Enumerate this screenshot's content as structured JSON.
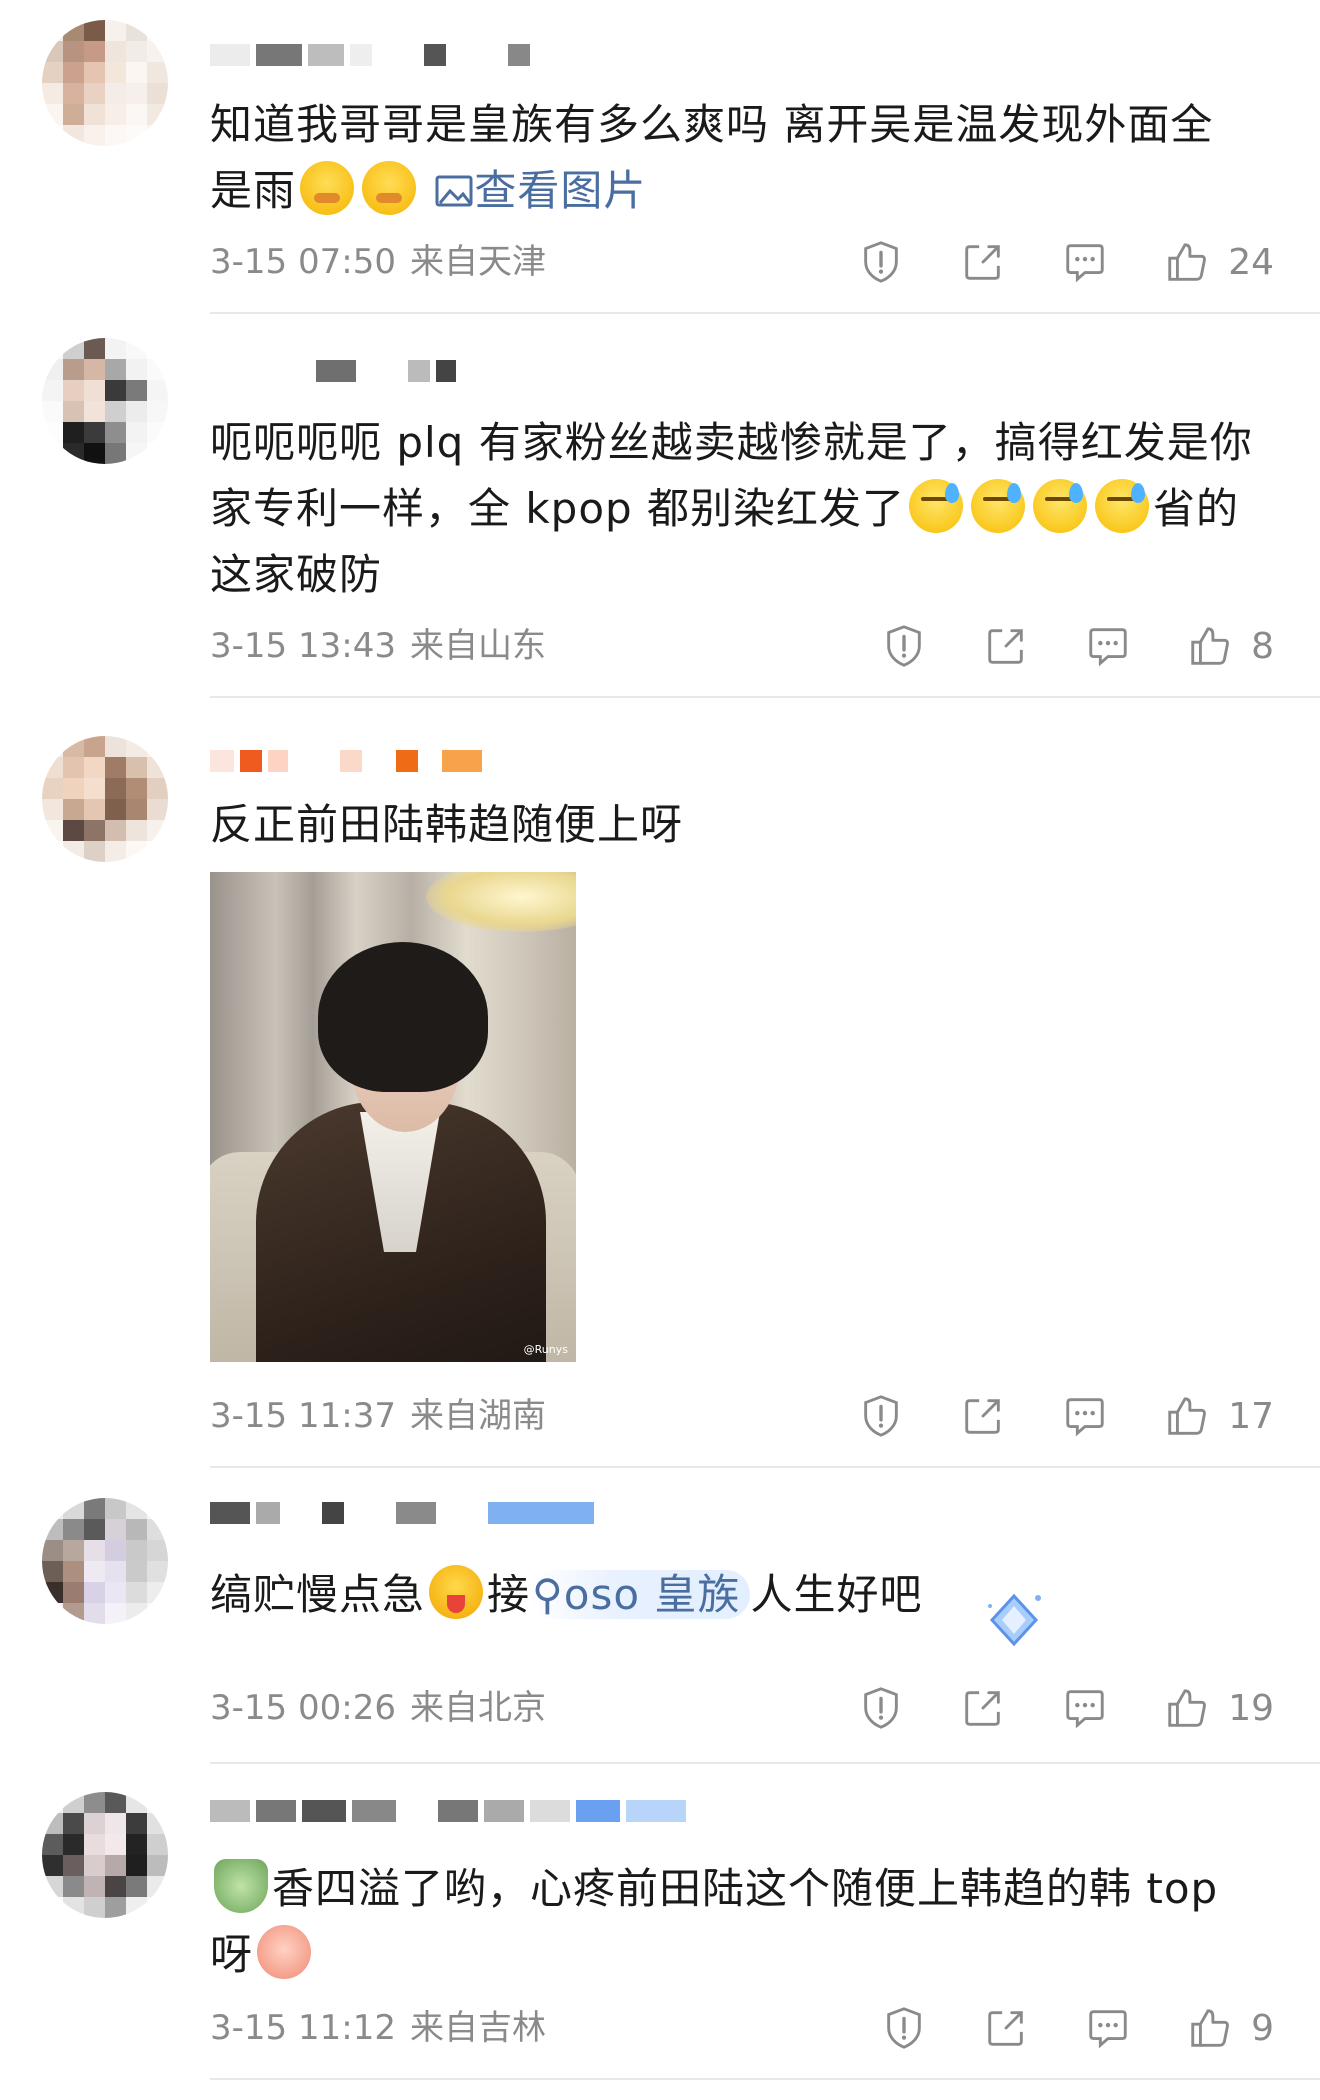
{
  "comments": [
    {
      "text_lines": [
        "知道我哥哥是皇族有多么爽吗 离开吴是温发现外面全",
        "是雨"
      ],
      "view_image_label": "查看图片",
      "date": "3-15 07:50",
      "location": "来自天津",
      "likes": "24"
    },
    {
      "text_lines": [
        "呃呃呃呃 plq 有家粉丝越卖越惨就是了，搞得红发是你",
        "家专利一样，全 kpop 都别染红发了",
        "这家破防"
      ],
      "text_after_emojis": "省的",
      "date": "3-15 13:43",
      "location": "来自山东",
      "likes": "8"
    },
    {
      "text": "反正前田陆韩趋随便上呀",
      "photo_watermark": "@Runys",
      "date": "3-15 11:37",
      "location": "来自湖南",
      "likes": "17"
    },
    {
      "text_before": "缟贮慢点急",
      "text_mid": "接",
      "mention": "oso 皇族",
      "text_after": "人生好吧",
      "date": "3-15 00:26",
      "location": "来自北京",
      "likes": "19"
    },
    {
      "text_line1": "香四溢了哟，心疼前田陆这个随便上韩趋的韩 top",
      "text_line2": "呀",
      "date": "3-15 11:12",
      "location": "来自吉林",
      "likes": "9"
    }
  ],
  "icons": {
    "report": "report-icon",
    "share": "share-icon",
    "reply": "comment-icon",
    "like": "thumbs-up-icon"
  },
  "colors": {
    "link": "#4a6ea0",
    "meta": "#8a8a8a",
    "divider": "#e8e8e8"
  }
}
